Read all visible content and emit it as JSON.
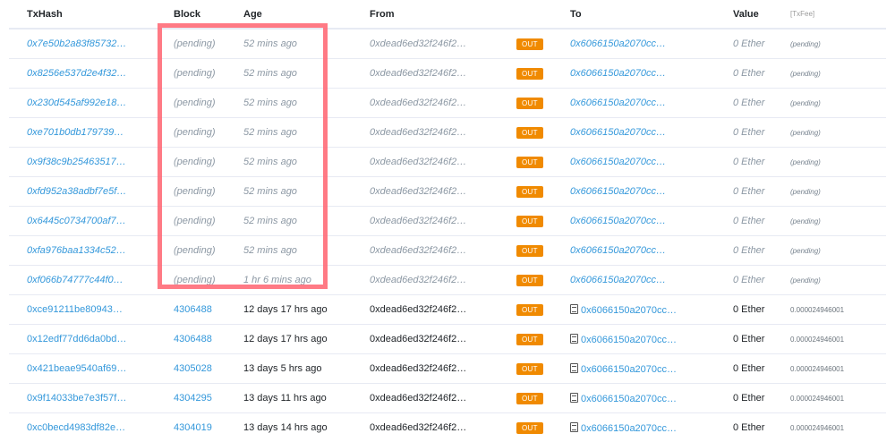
{
  "columns": {
    "txhash": "TxHash",
    "block": "Block",
    "age": "Age",
    "from": "From",
    "to": "To",
    "value": "Value",
    "txfee": "[TxFee]"
  },
  "rows": [
    {
      "hash": "0x7e50b2a83f85732…",
      "block": "(pending)",
      "age": "52 mins ago",
      "from": "0xdead6ed32f246f2…",
      "dir": "OUT",
      "to": "0x6066150a2070cc…",
      "value": "0 Ether",
      "fee": "(pending)"
    },
    {
      "hash": "0x8256e537d2e4f32…",
      "block": "(pending)",
      "age": "52 mins ago",
      "from": "0xdead6ed32f246f2…",
      "dir": "OUT",
      "to": "0x6066150a2070cc…",
      "value": "0 Ether",
      "fee": "(pending)"
    },
    {
      "hash": "0x230d545af992e18…",
      "block": "(pending)",
      "age": "52 mins ago",
      "from": "0xdead6ed32f246f2…",
      "dir": "OUT",
      "to": "0x6066150a2070cc…",
      "value": "0 Ether",
      "fee": "(pending)"
    },
    {
      "hash": "0xe701b0db179739…",
      "block": "(pending)",
      "age": "52 mins ago",
      "from": "0xdead6ed32f246f2…",
      "dir": "OUT",
      "to": "0x6066150a2070cc…",
      "value": "0 Ether",
      "fee": "(pending)"
    },
    {
      "hash": "0x9f38c9b25463517…",
      "block": "(pending)",
      "age": "52 mins ago",
      "from": "0xdead6ed32f246f2…",
      "dir": "OUT",
      "to": "0x6066150a2070cc…",
      "value": "0 Ether",
      "fee": "(pending)"
    },
    {
      "hash": "0xfd952a38adbf7e5f…",
      "block": "(pending)",
      "age": "52 mins ago",
      "from": "0xdead6ed32f246f2…",
      "dir": "OUT",
      "to": "0x6066150a2070cc…",
      "value": "0 Ether",
      "fee": "(pending)"
    },
    {
      "hash": "0x6445c0734700af7…",
      "block": "(pending)",
      "age": "52 mins ago",
      "from": "0xdead6ed32f246f2…",
      "dir": "OUT",
      "to": "0x6066150a2070cc…",
      "value": "0 Ether",
      "fee": "(pending)"
    },
    {
      "hash": "0xfa976baa1334c52…",
      "block": "(pending)",
      "age": "52 mins ago",
      "from": "0xdead6ed32f246f2…",
      "dir": "OUT",
      "to": "0x6066150a2070cc…",
      "value": "0 Ether",
      "fee": "(pending)"
    },
    {
      "hash": "0xf066b74777c44f0…",
      "block": "(pending)",
      "age": "1 hr 6 mins ago",
      "from": "0xdead6ed32f246f2…",
      "dir": "OUT",
      "to": "0x6066150a2070cc…",
      "value": "0 Ether",
      "fee": "(pending)"
    },
    {
      "hash": "0xce91211be80943…",
      "block": "4306488",
      "age": "12 days 17 hrs ago",
      "from": "0xdead6ed32f246f2…",
      "dir": "OUT",
      "to": "0x6066150a2070cc…",
      "value": "0 Ether",
      "fee": "0.000024946001",
      "contract": true
    },
    {
      "hash": "0x12edf77dd6da0bd…",
      "block": "4306488",
      "age": "12 days 17 hrs ago",
      "from": "0xdead6ed32f246f2…",
      "dir": "OUT",
      "to": "0x6066150a2070cc…",
      "value": "0 Ether",
      "fee": "0.000024946001",
      "contract": true
    },
    {
      "hash": "0x421beae9540af69…",
      "block": "4305028",
      "age": "13 days 5 hrs ago",
      "from": "0xdead6ed32f246f2…",
      "dir": "OUT",
      "to": "0x6066150a2070cc…",
      "value": "0 Ether",
      "fee": "0.000024946001",
      "contract": true
    },
    {
      "hash": "0x9f14033be7e3f57f…",
      "block": "4304295",
      "age": "13 days 11 hrs ago",
      "from": "0xdead6ed32f246f2…",
      "dir": "OUT",
      "to": "0x6066150a2070cc…",
      "value": "0 Ether",
      "fee": "0.000024946001",
      "contract": true
    },
    {
      "hash": "0xc0becd4983df82e…",
      "block": "4304019",
      "age": "13 days 14 hrs ago",
      "from": "0xdead6ed32f246f2…",
      "dir": "OUT",
      "to": "0x6066150a2070cc…",
      "value": "0 Ether",
      "fee": "0.000024946001",
      "contract": true
    }
  ],
  "colors": {
    "accent": "#3498db",
    "out_badge": "#f08a00",
    "highlight": "#ff6b78"
  },
  "icons": {
    "contract": "file-doc-icon"
  }
}
